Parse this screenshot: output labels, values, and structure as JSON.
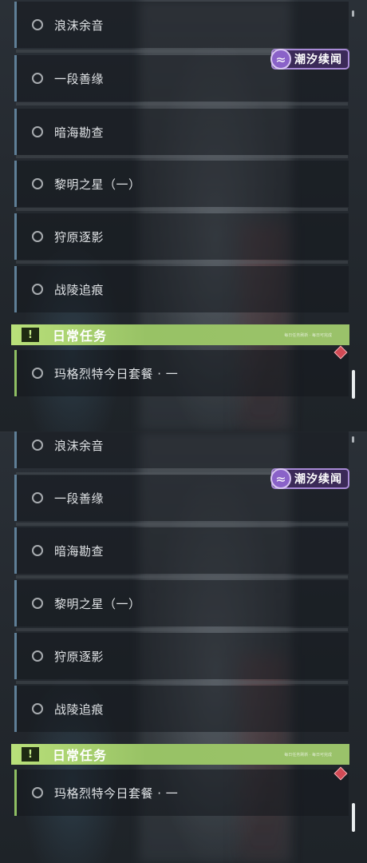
{
  "quests": [
    {
      "label": "浪沫余音"
    },
    {
      "label": "一段善缘"
    },
    {
      "label": "暗海勘查"
    },
    {
      "label": "黎明之星（一）"
    },
    {
      "label": "狩原逐影"
    },
    {
      "label": "战陵追痕"
    }
  ],
  "daily_section": {
    "icon_label": "!",
    "title": "日常任务",
    "small_text": "每日任务刷新 · 每日可完成"
  },
  "daily_quests": [
    {
      "label": "玛格烈特今日套餐 · 一"
    }
  ],
  "event_badge": {
    "label": "潮汐续闻"
  },
  "colors": {
    "accent_blue": "#5f7f97",
    "accent_green": "#98c265",
    "badge_purple": "#8a62c8",
    "marker_red": "#d24a55"
  }
}
